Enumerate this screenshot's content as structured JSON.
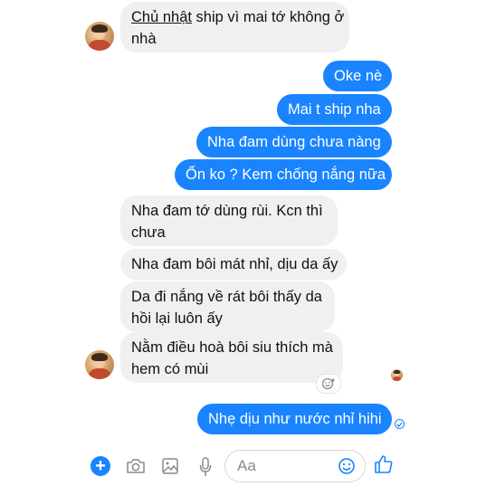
{
  "conversation": {
    "messages": [
      {
        "direction": "in",
        "underlined_word": "Chủ nhật",
        "lines": [
          " ship vì mai tớ không ở",
          "nhà"
        ]
      },
      {
        "direction": "out",
        "text": "Oke nè"
      },
      {
        "direction": "out",
        "text": "Mai t ship nha"
      },
      {
        "direction": "out",
        "text": "Nha đam dùng chưa nàng"
      },
      {
        "direction": "out",
        "text": "Ổn ko ? Kem chống nắng nữa"
      },
      {
        "direction": "in",
        "lines": [
          "Nha đam tớ dùng rùi. Kcn thì",
          "chưa"
        ]
      },
      {
        "direction": "in",
        "text": "Nha đam bôi mát nhỉ, dịu da ấy"
      },
      {
        "direction": "in",
        "lines": [
          "Da đi nắng về rát bôi thấy da",
          "hồi lại luôn ấy"
        ]
      },
      {
        "direction": "in",
        "lines": [
          "Nằm điều hoà bôi siu thích mà",
          "hem có mùi"
        ]
      },
      {
        "direction": "out",
        "text": "Nhẹ dịu như nước nhỉ hihi"
      }
    ]
  },
  "composer": {
    "placeholder": "Aa",
    "icons": [
      "plus-icon",
      "camera-icon",
      "image-icon",
      "microphone-icon",
      "emoji-icon",
      "thumbs-up-icon"
    ]
  },
  "colors": {
    "accent": "#1a84ff",
    "incoming_bubble": "#f0f0f0"
  }
}
